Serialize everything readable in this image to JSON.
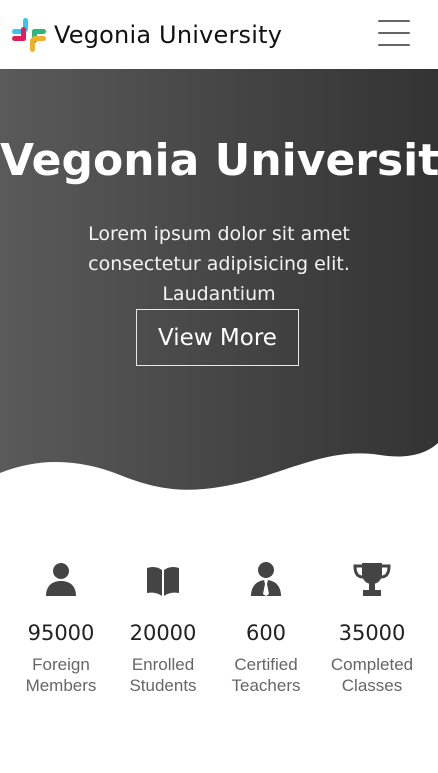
{
  "navbar": {
    "logo_icon": "slack-style-colorful-logo-icon",
    "brand": "Vegonia University",
    "menu_icon": "hamburger-menu-icon"
  },
  "hero": {
    "title": "Vegonia University",
    "text": "Lorem ipsum dolor sit amet consectetur adipisicing elit. Laudantium",
    "button_label": "View More",
    "gradient_colors": [
      "#5a5a5a",
      "#333333"
    ]
  },
  "stats": [
    {
      "icon": "person-icon",
      "value": "95000",
      "label_line1": "Foreign",
      "label_line2": "Members"
    },
    {
      "icon": "open-book-icon",
      "value": "20000",
      "label_line1": "Enrolled",
      "label_line2": "Students"
    },
    {
      "icon": "person-with-tie-icon",
      "value": "600",
      "label_line1": "Certified",
      "label_line2": "Teachers"
    },
    {
      "icon": "trophy-icon",
      "value": "35000",
      "label_line1": "Completed",
      "label_line2": "Classes"
    }
  ],
  "colors": {
    "icon_color": "#444444",
    "label_color": "#666666"
  }
}
